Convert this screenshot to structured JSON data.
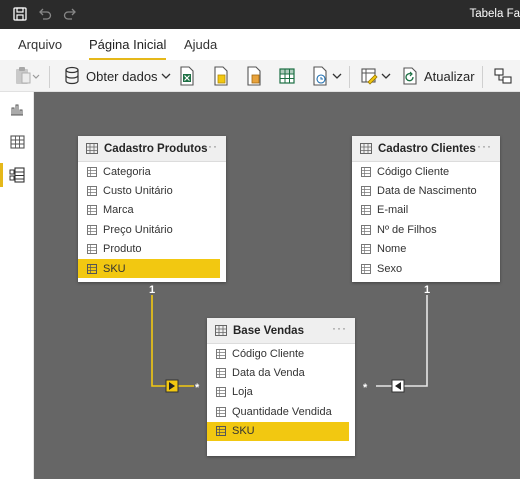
{
  "window": {
    "title": "Tabela Fa"
  },
  "ribbon": {
    "tabs": [
      {
        "label": "Arquivo"
      },
      {
        "label": "Página Inicial"
      },
      {
        "label": "Ajuda"
      }
    ],
    "active_tab": "Página Inicial"
  },
  "toolbar": {
    "get_data_label": "Obter dados",
    "refresh_label": "Atualizar"
  },
  "views": [
    "report-view",
    "data-view",
    "model-view"
  ],
  "model": {
    "tables": {
      "produtos": {
        "name": "Cadastro Produtos",
        "fields": [
          "Categoria",
          "Custo Unitário",
          "Marca",
          "Preço Unitário",
          "Produto",
          "SKU"
        ],
        "highlighted": "SKU"
      },
      "clientes": {
        "name": "Cadastro Clientes",
        "fields": [
          "Código Cliente",
          "Data de Nascimento",
          "E-mail",
          "Nº de Filhos",
          "Nome",
          "Sexo"
        ]
      },
      "vendas": {
        "name": "Base Vendas",
        "fields": [
          "Código Cliente",
          "Data da Venda",
          "Loja",
          "Quantidade Vendida",
          "SKU"
        ],
        "highlighted": "SKU"
      }
    },
    "relationships": [
      {
        "from": "Cadastro Produtos",
        "to": "Base Vendas",
        "one_side_label": "1",
        "many_side_label": "*",
        "highlighted": true
      },
      {
        "from": "Cadastro Clientes",
        "to": "Base Vendas",
        "one_side_label": "1",
        "many_side_label": "*",
        "highlighted": false
      }
    ],
    "more_label": "···"
  },
  "colors": {
    "accent": "#f2c811",
    "canvas": "#666666",
    "titlebar": "#2b2b2b"
  }
}
